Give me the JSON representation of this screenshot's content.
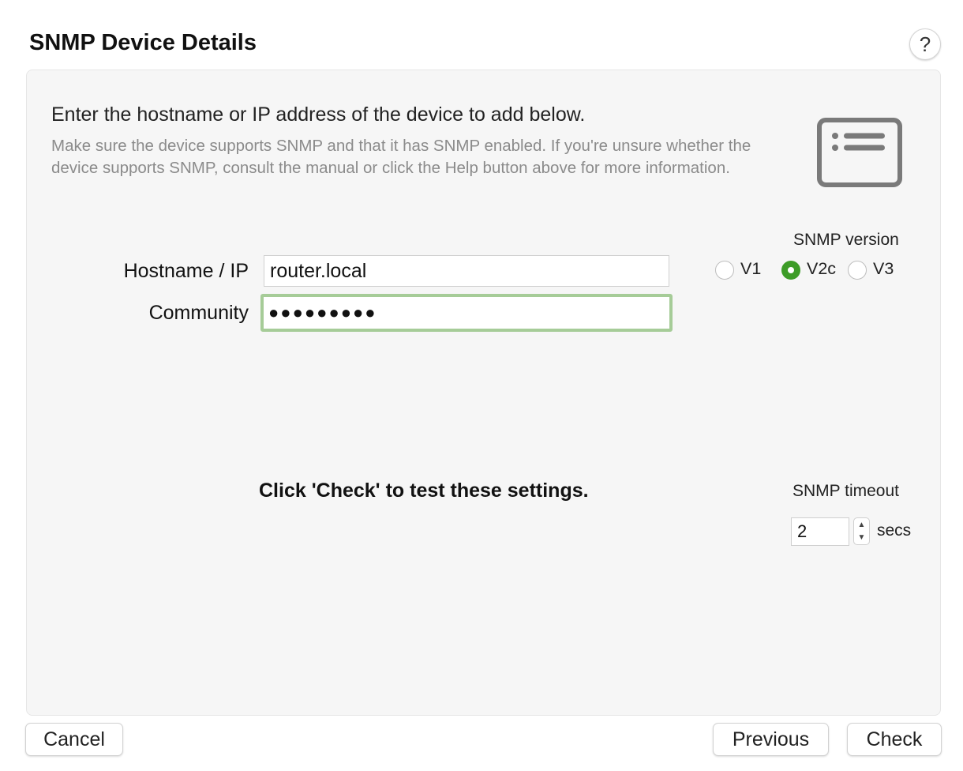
{
  "dialog": {
    "title": "SNMP Device Details",
    "help_label": "?"
  },
  "panel": {
    "heading": "Enter the hostname or IP address of the device to add below.",
    "description": "Make sure the device supports SNMP and that it has SNMP enabled. If you're unsure whether the device supports SNMP, consult the manual or click the Help button above for more information.",
    "icon": "device-card-icon"
  },
  "form": {
    "hostname_label": "Hostname / IP",
    "hostname_value": "router.local",
    "community_label": "Community",
    "community_value": "●●●●●●●●●",
    "community_focused": true
  },
  "snmp_version": {
    "label": "SNMP version",
    "options": [
      "V1",
      "V2c",
      "V3"
    ],
    "selected": "V2c"
  },
  "check_message": "Click 'Check' to test these settings.",
  "timeout": {
    "label": "SNMP timeout",
    "value": "2",
    "unit": "secs"
  },
  "buttons": {
    "cancel": "Cancel",
    "previous": "Previous",
    "check": "Check"
  },
  "colors": {
    "accent": "#3d9c27",
    "focus_ring": "#a6cc98"
  }
}
